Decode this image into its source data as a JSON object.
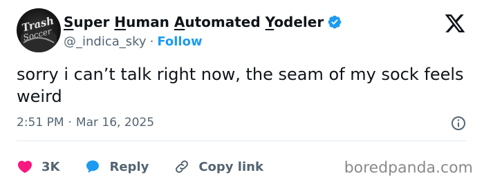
{
  "author": {
    "display_name_parts": [
      "S",
      "uper ",
      "H",
      "uman ",
      "A",
      "utomated ",
      "Y",
      "odeler"
    ],
    "avatar_text_1": "Trash",
    "avatar_text_2": "Soccer",
    "handle": "@_indica_sky",
    "separator": "·",
    "follow_label": "Follow"
  },
  "tweet": {
    "text": "sorry i can’t talk right now, the seam of my sock feels weird",
    "time": "2:51 PM",
    "separator": "·",
    "date": "Mar 16, 2025"
  },
  "actions": {
    "like_count": "3K",
    "reply_label": "Reply",
    "copy_link_label": "Copy link"
  },
  "watermark": "boredpanda.com",
  "colors": {
    "like": "#f91880",
    "reply": "#1d9bf0",
    "verified": "#1d9bf0",
    "follow": "#1d9bf0",
    "secondary_text": "#536471"
  },
  "icons": {
    "verified": "verified-badge-icon",
    "x_logo": "x-logo-icon",
    "info": "info-icon",
    "like": "heart-icon",
    "reply": "speech-bubble-icon",
    "copy_link": "link-icon"
  }
}
